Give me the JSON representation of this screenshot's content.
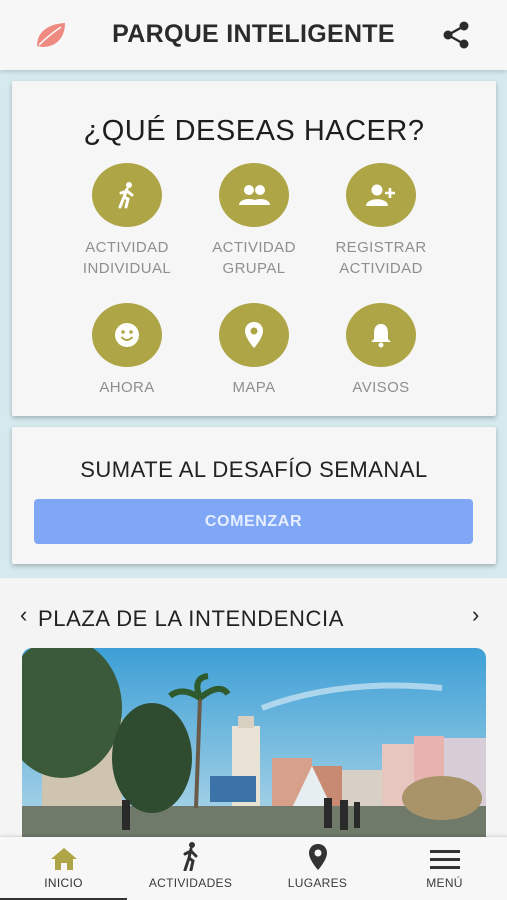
{
  "app": {
    "title": "PARQUE INTELIGENTE"
  },
  "colors": {
    "accent": "#aea546",
    "button": "#7fa7f5",
    "logo": "#ef8a80",
    "sky_bg": "#d5eaee"
  },
  "header": {
    "logo_icon": "leaf-icon",
    "share_icon": "share-icon"
  },
  "actions": {
    "question": "¿QUÉ DESEAS HACER?",
    "items": [
      {
        "icon": "walking-person-icon",
        "line1": "ACTIVIDAD",
        "line2": "INDIVIDUAL"
      },
      {
        "icon": "group-icon",
        "line1": "ACTIVIDAD",
        "line2": "GRUPAL"
      },
      {
        "icon": "add-person-icon",
        "line1": "REGISTRAR",
        "line2": "ACTIVIDAD"
      },
      {
        "icon": "smiley-icon",
        "line1": "AHORA",
        "line2": ""
      },
      {
        "icon": "map-pin-icon",
        "line1": "MAPA",
        "line2": ""
      },
      {
        "icon": "bell-icon",
        "line1": "AVISOS",
        "line2": ""
      }
    ]
  },
  "challenge": {
    "title": "SUMATE AL DESAFÍO SEMANAL",
    "button": "COMENZAR"
  },
  "place": {
    "prev": "‹",
    "name": "PLAZA DE LA INTENDENCIA",
    "next": "›"
  },
  "nav": {
    "items": [
      {
        "label": "INICIO",
        "icon": "home-icon",
        "active": true
      },
      {
        "label": "ACTIVIDADES",
        "icon": "walking-icon",
        "active": false
      },
      {
        "label": "LUGARES",
        "icon": "location-pin-icon",
        "active": false
      },
      {
        "label": "MENÚ",
        "icon": "hamburger-menu-icon",
        "active": false
      }
    ]
  }
}
